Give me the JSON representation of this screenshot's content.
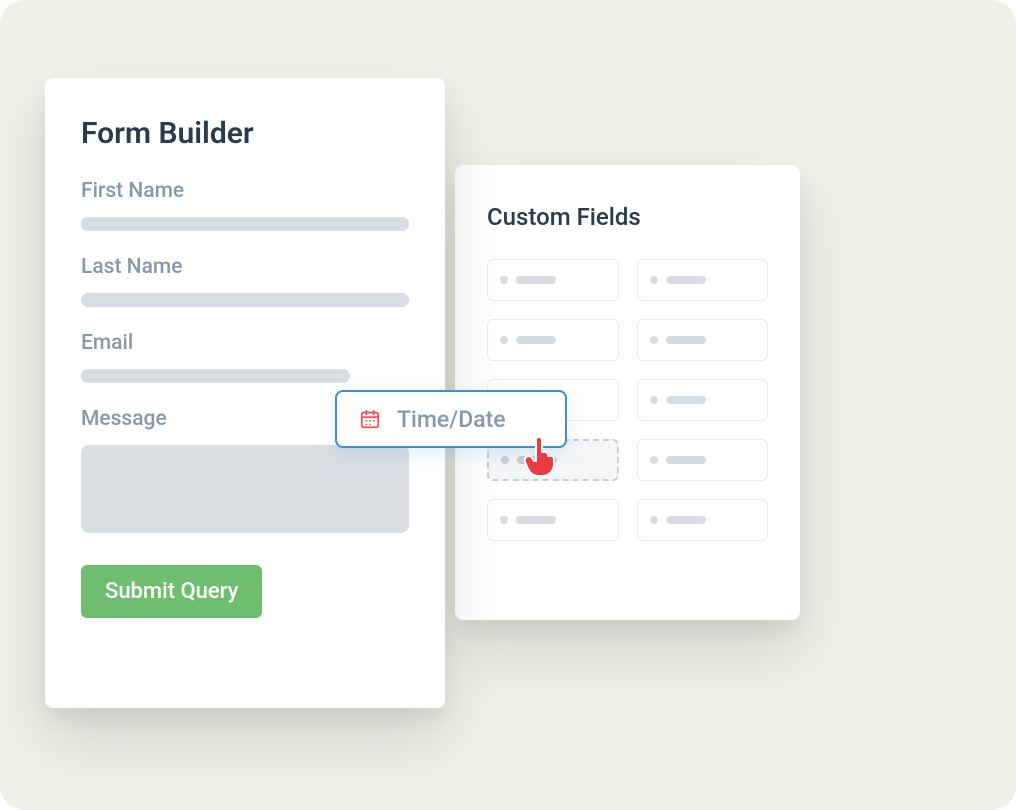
{
  "form": {
    "title": "Form Builder",
    "fields": {
      "first_name_label": "First Name",
      "last_name_label": "Last Name",
      "email_label": "Email",
      "message_label": "Message"
    },
    "submit_label": "Submit Query"
  },
  "custom_fields": {
    "title": "Custom Fields"
  },
  "dragging": {
    "label": "Time/Date",
    "icon": "calendar-icon"
  },
  "colors": {
    "accent_blue": "#3b8fd6",
    "accent_red": "#ea5659",
    "accent_green": "#6fbe6f",
    "text_dark": "#2a3b4f",
    "text_muted": "#8a97ab"
  }
}
